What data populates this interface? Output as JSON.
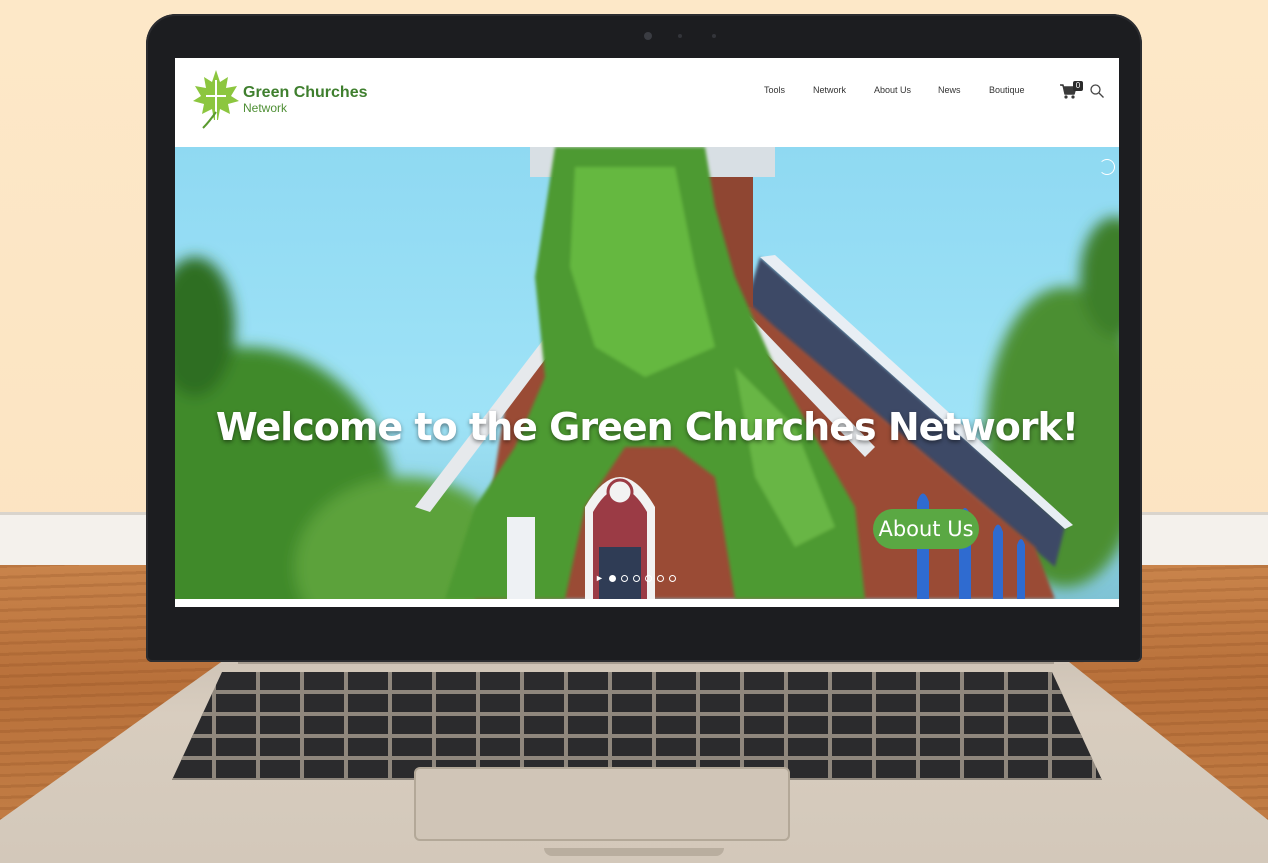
{
  "site": {
    "logo_title": "Green Churches",
    "logo_subtitle": "Network",
    "nav": [
      "Tools",
      "Network",
      "About Us",
      "News",
      "Boutique"
    ],
    "cart_count": "0"
  },
  "hero": {
    "heading": "Welcome to the Green Churches Network!",
    "button_label": "About Us",
    "slides": 6,
    "active_slide": 1
  },
  "colors": {
    "brand_green": "#5aa843",
    "logo_green": "#3f7f2e"
  },
  "icons": [
    "maple-leaf-logo-icon",
    "cart-icon",
    "search-icon",
    "play-icon",
    "loading-spinner-icon"
  ]
}
